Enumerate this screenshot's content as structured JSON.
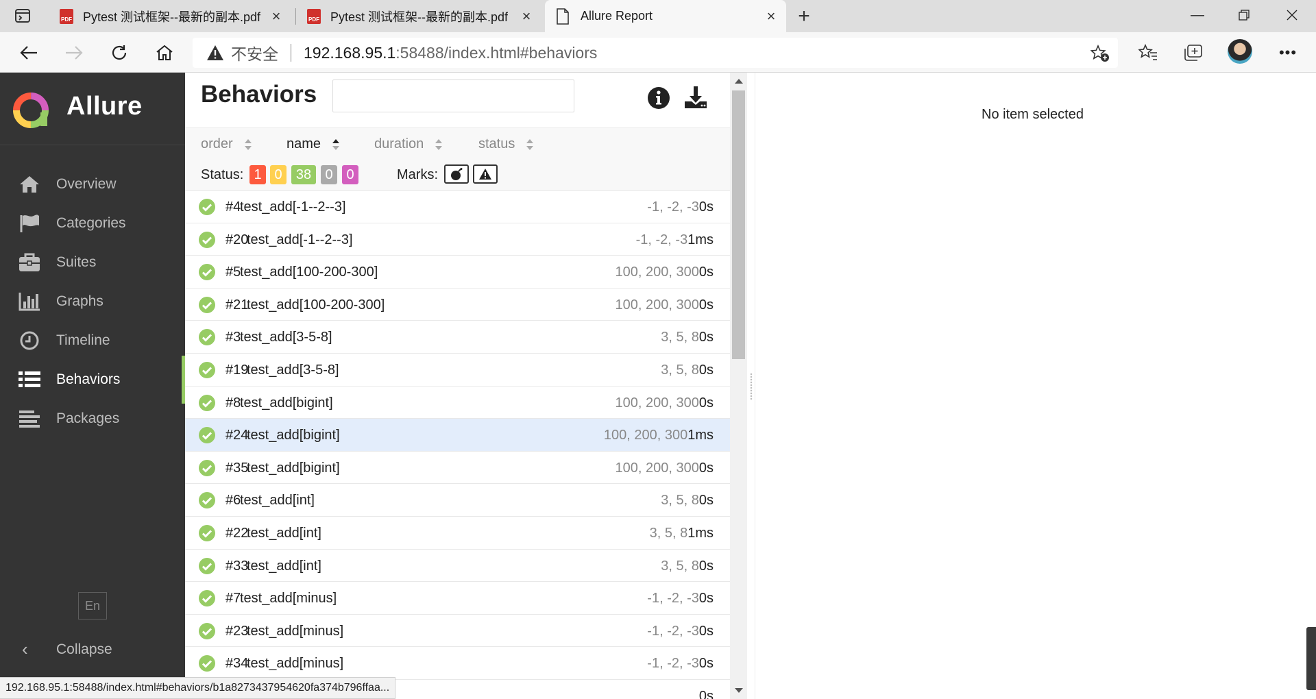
{
  "browser": {
    "tabs": [
      {
        "title": "Pytest 测试框架--最新的副本.pdf",
        "icon": "pdf-icon",
        "active": false
      },
      {
        "title": "Pytest 测试框架--最新的副本.pdf",
        "icon": "pdf-icon",
        "active": false
      },
      {
        "title": "Allure Report",
        "icon": "page-icon",
        "active": true
      }
    ],
    "pdf_badge": "PDF",
    "address": {
      "insecure_label": "不安全",
      "host": "192.168.95.1",
      "path": ":58488/index.html#behaviors"
    },
    "status_url": "192.168.95.1:58488/index.html#behaviors/b1a8273437954620fa374b796ffaa..."
  },
  "sidebar": {
    "brand": "Allure",
    "items": [
      {
        "label": "Overview",
        "icon": "home-icon",
        "active": false
      },
      {
        "label": "Categories",
        "icon": "flag-icon",
        "active": false
      },
      {
        "label": "Suites",
        "icon": "briefcase-icon",
        "active": false
      },
      {
        "label": "Graphs",
        "icon": "bar-chart-icon",
        "active": false
      },
      {
        "label": "Timeline",
        "icon": "clock-icon",
        "active": false
      },
      {
        "label": "Behaviors",
        "icon": "list-icon",
        "active": true
      },
      {
        "label": "Packages",
        "icon": "align-left-icon",
        "active": false
      }
    ],
    "language": "En",
    "collapse_label": "Collapse",
    "accent_color": "#97cc64"
  },
  "behaviors": {
    "title": "Behaviors",
    "search_value": "",
    "sorters": [
      {
        "label": "order",
        "active": false
      },
      {
        "label": "name",
        "active": true
      },
      {
        "label": "duration",
        "active": false
      },
      {
        "label": "status",
        "active": false
      }
    ],
    "status_label": "Status:",
    "status_counts": [
      {
        "status": "failed",
        "count": "1",
        "color": "#fd5a3e"
      },
      {
        "status": "broken",
        "count": "0",
        "color": "#ffd050"
      },
      {
        "status": "passed",
        "count": "38",
        "color": "#97cc64"
      },
      {
        "status": "skipped",
        "count": "0",
        "color": "#aaaaaa"
      },
      {
        "status": "unknown",
        "count": "0",
        "color": "#d35ebe"
      }
    ],
    "marks_label": "Marks:",
    "marks": [
      "bomb-icon",
      "warning-icon"
    ],
    "rows": [
      {
        "num": "#4",
        "name": "test_add[-1--2--3]",
        "params": "-1, -2, -3",
        "duration": "0s",
        "selected": false
      },
      {
        "num": "#20",
        "name": "test_add[-1--2--3]",
        "params": "-1, -2, -3",
        "duration": "1ms",
        "selected": false
      },
      {
        "num": "#5",
        "name": "test_add[100-200-300]",
        "params": "100, 200, 300",
        "duration": "0s",
        "selected": false
      },
      {
        "num": "#21",
        "name": "test_add[100-200-300]",
        "params": "100, 200, 300",
        "duration": "0s",
        "selected": false
      },
      {
        "num": "#3",
        "name": "test_add[3-5-8]",
        "params": "3, 5, 8",
        "duration": "0s",
        "selected": false
      },
      {
        "num": "#19",
        "name": "test_add[3-5-8]",
        "params": "3, 5, 8",
        "duration": "0s",
        "selected": false
      },
      {
        "num": "#8",
        "name": "test_add[bigint]",
        "params": "100, 200, 300",
        "duration": "0s",
        "selected": false
      },
      {
        "num": "#24",
        "name": "test_add[bigint]",
        "params": "100, 200, 300",
        "duration": "1ms",
        "selected": true
      },
      {
        "num": "#35",
        "name": "test_add[bigint]",
        "params": "100, 200, 300",
        "duration": "0s",
        "selected": false
      },
      {
        "num": "#6",
        "name": "test_add[int]",
        "params": "3, 5, 8",
        "duration": "0s",
        "selected": false
      },
      {
        "num": "#22",
        "name": "test_add[int]",
        "params": "3, 5, 8",
        "duration": "1ms",
        "selected": false
      },
      {
        "num": "#33",
        "name": "test_add[int]",
        "params": "3, 5, 8",
        "duration": "0s",
        "selected": false
      },
      {
        "num": "#7",
        "name": "test_add[minus]",
        "params": "-1, -2, -3",
        "duration": "0s",
        "selected": false
      },
      {
        "num": "#23",
        "name": "test_add[minus]",
        "params": "-1, -2, -3",
        "duration": "0s",
        "selected": false
      },
      {
        "num": "#34",
        "name": "test_add[minus]",
        "params": "-1, -2, -3",
        "duration": "0s",
        "selected": false
      },
      {
        "num": "",
        "name": "",
        "params": "",
        "duration": "0s",
        "selected": false
      }
    ]
  },
  "detail": {
    "empty_text": "No item selected"
  }
}
